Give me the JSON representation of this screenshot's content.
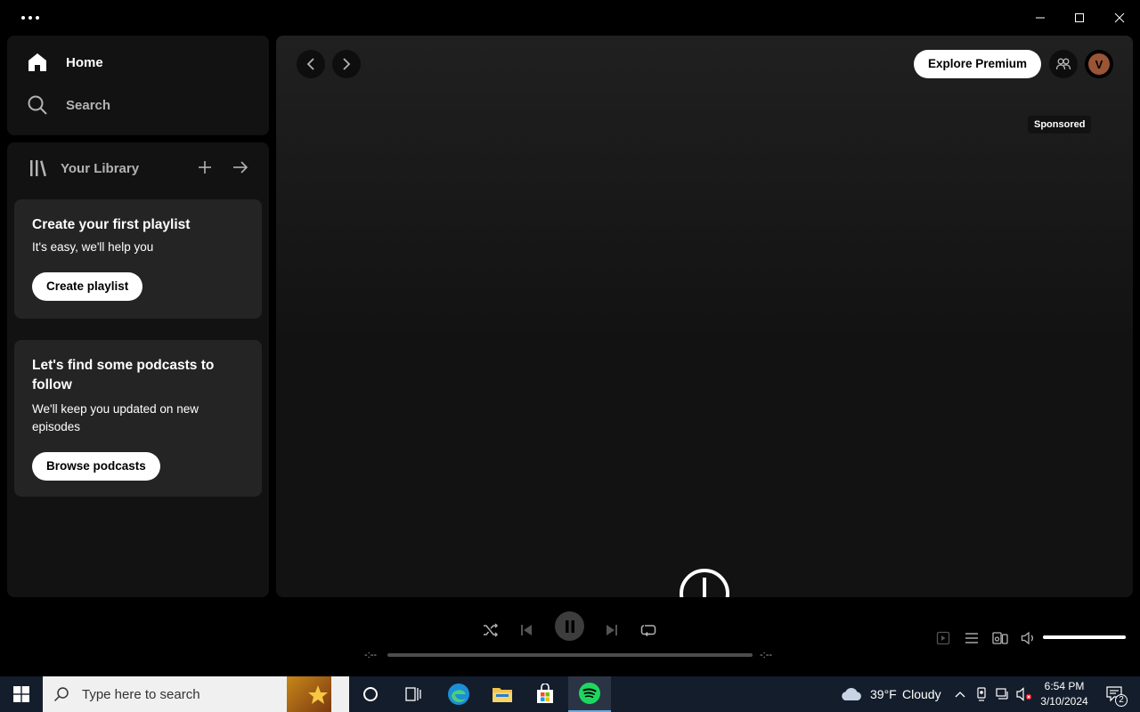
{
  "window": {
    "minimize_label": "Minimize",
    "maximize_label": "Maximize",
    "close_label": "Close"
  },
  "nav": {
    "home": "Home",
    "search": "Search"
  },
  "library": {
    "title": "Your Library",
    "playlist_card": {
      "title": "Create your first playlist",
      "subtitle": "It's easy, we'll help you",
      "button": "Create playlist"
    },
    "podcast_card": {
      "title": "Let's find some podcasts to follow",
      "subtitle": "We'll keep you updated on new episodes",
      "button": "Browse podcasts"
    }
  },
  "main": {
    "explore_premium": "Explore Premium",
    "avatar_initial": "V",
    "sponsored": "Sponsored"
  },
  "player": {
    "elapsed": "-:--",
    "duration": "-:--",
    "progress": 0,
    "volume": 1.0,
    "state": "playing"
  },
  "taskbar": {
    "search_placeholder": "Type here to search",
    "weather_temp": "39°F",
    "weather_desc": "Cloudy",
    "time": "6:54 PM",
    "date": "3/10/2024",
    "notification_count": "2"
  },
  "colors": {
    "accent_green": "#1ed760",
    "background": "#000000",
    "panel": "#121212",
    "card": "#242424"
  }
}
